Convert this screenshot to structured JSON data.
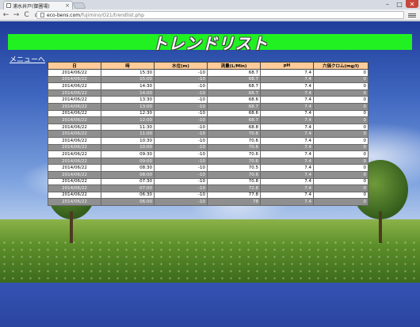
{
  "browser": {
    "tab_title": "浦水井戸(御圃場)",
    "close_glyph": "×",
    "url_host": "eco-bens.com",
    "url_path": "/fujimino/O21/trendlist.php",
    "back_glyph": "←",
    "forward_glyph": "→",
    "reload_glyph": "C",
    "home_glyph": "⌂",
    "min_glyph": "–",
    "max_glyph": "□",
    "close_window_glyph": "✕"
  },
  "page": {
    "title": "トレンドリスト",
    "menu_link": "メニューへ"
  },
  "table": {
    "headers": [
      "日",
      "時",
      "水位(m)",
      "流量(L/Min)",
      "pH",
      "六価クロム(mg/l)"
    ],
    "rows": [
      [
        "2014/06/22",
        "15:30",
        "-10",
        "68.7",
        "7.4",
        "0"
      ],
      [
        "2014/06/22",
        "15:00",
        "-10",
        "68.7",
        "7.4",
        "0"
      ],
      [
        "2014/06/22",
        "14:30",
        "-10",
        "68.7",
        "7.4",
        "0"
      ],
      [
        "2014/06/22",
        "14:00",
        "-10",
        "68.7",
        "7.4",
        "0"
      ],
      [
        "2014/06/22",
        "13:30",
        "-10",
        "68.6",
        "7.4",
        "0"
      ],
      [
        "2014/06/22",
        "13:00",
        "-10",
        "68.7",
        "7.4",
        "0"
      ],
      [
        "2014/06/22",
        "12:30",
        "-10",
        "68.6",
        "7.4",
        "0"
      ],
      [
        "2014/06/22",
        "12:00",
        "-10",
        "68.7",
        "7.4",
        "0"
      ],
      [
        "2014/06/22",
        "11:30",
        "-10",
        "68.8",
        "7.4",
        "0"
      ],
      [
        "2014/06/22",
        "11:00",
        "-10",
        "70.6",
        "7.4",
        "0"
      ],
      [
        "2014/06/22",
        "10:30",
        "-10",
        "70.6",
        "7.4",
        "0"
      ],
      [
        "2014/06/22",
        "10:00",
        "-10",
        "70.6",
        "7.4",
        "0"
      ],
      [
        "2014/06/22",
        "09:30",
        "-10",
        "70.6",
        "7.4",
        "0"
      ],
      [
        "2014/06/22",
        "09:00",
        "-10",
        "70.6",
        "7.4",
        "0"
      ],
      [
        "2014/06/22",
        "08:30",
        "-10",
        "70.5",
        "7.4",
        "0"
      ],
      [
        "2014/06/22",
        "08:00",
        "-10",
        "70.6",
        "7.4",
        "0"
      ],
      [
        "2014/06/22",
        "07:30",
        "-10",
        "70.8",
        "7.4",
        "0"
      ],
      [
        "2014/06/22",
        "07:00",
        "-10",
        "72.8",
        "7.4",
        "0"
      ],
      [
        "2014/06/22",
        "06:30",
        "-10",
        "77.8",
        "7.4",
        "0"
      ],
      [
        "2014/06/22",
        "06:00",
        "-10",
        "78",
        "7.4",
        "0"
      ]
    ]
  },
  "colors": {
    "banner": "#21f121",
    "header_bg": "#ffcc99",
    "row_light": "#ffffff",
    "row_dark": "#8f8f8f"
  }
}
